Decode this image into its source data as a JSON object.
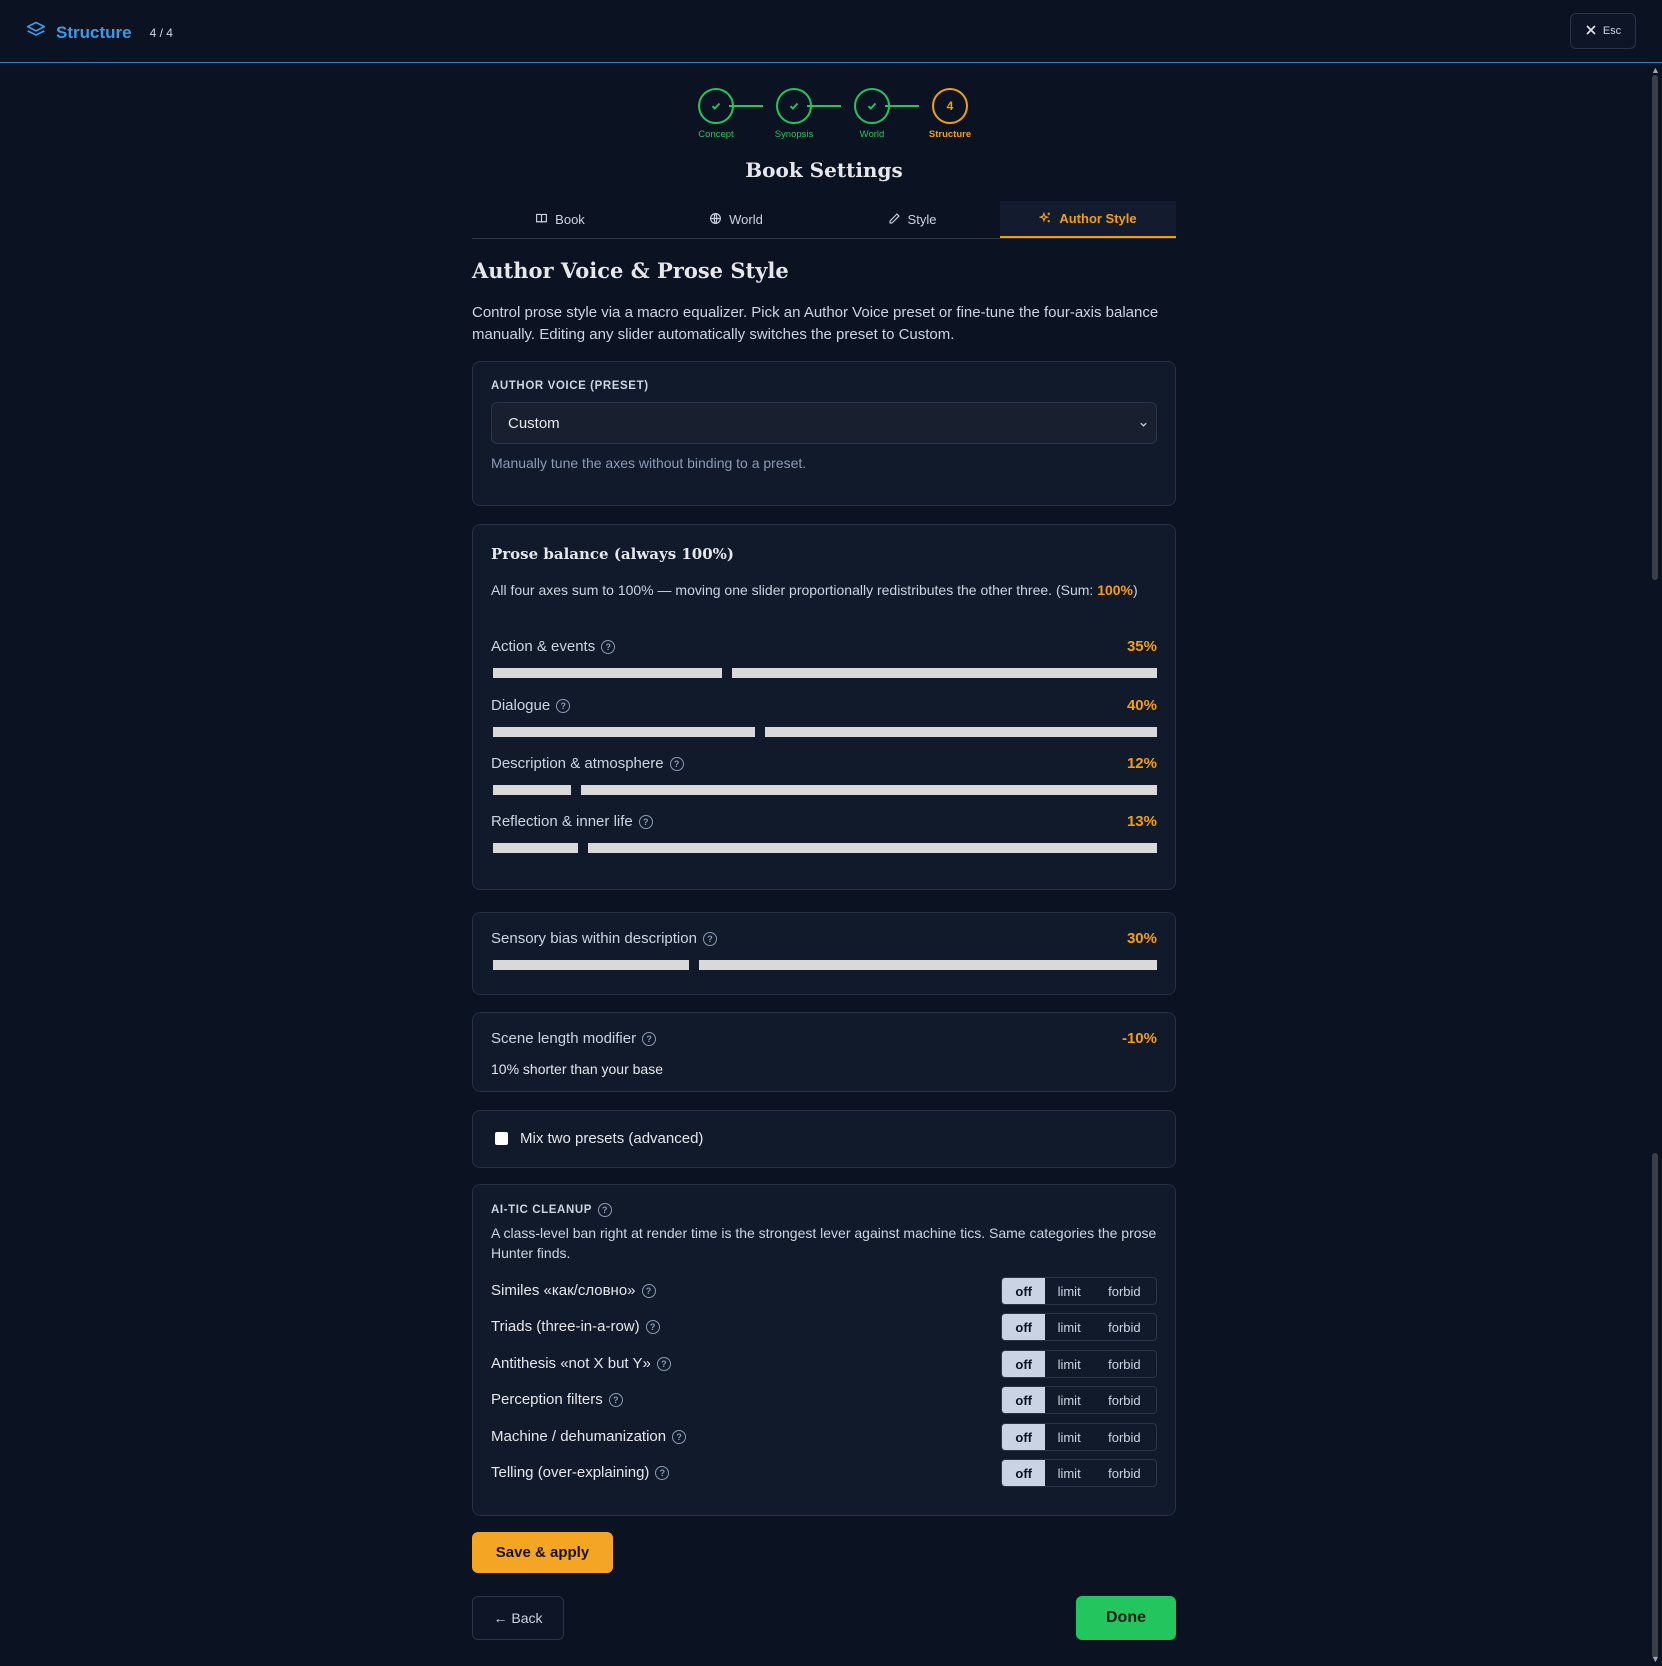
{
  "header": {
    "title": "Structure",
    "step_count": "4 / 4",
    "close_label": "Esc",
    "icons": {
      "logo": "layers-icon",
      "close": "close-icon"
    }
  },
  "stepper": {
    "steps": [
      {
        "label": "Concept",
        "state": "done",
        "icon": "check-icon"
      },
      {
        "label": "Synopsis",
        "state": "done",
        "icon": "check-icon"
      },
      {
        "label": "World",
        "state": "done",
        "icon": "check-icon"
      },
      {
        "label": "Structure",
        "state": "active",
        "number": "4"
      }
    ]
  },
  "page_title": "Book Settings",
  "tabs": [
    {
      "label": "Book",
      "icon": "book-icon"
    },
    {
      "label": "World",
      "icon": "globe-icon"
    },
    {
      "label": "Style",
      "icon": "pencil-icon"
    },
    {
      "label": "Author Style",
      "icon": "sparkles-icon",
      "active": true
    }
  ],
  "section": {
    "title": "Author Voice & Prose Style",
    "intro": "Control prose style via a macro equalizer. Pick an Author Voice preset or fine-tune the four-axis balance manually. Editing any slider automatically switches the preset to Custom."
  },
  "preset": {
    "caption": "AUTHOR VOICE (PRESET)",
    "selected": "Custom",
    "hint": "Manually tune the axes without binding to a preset."
  },
  "balance": {
    "title": "Prose balance (always 100%)",
    "description_prefix": "All four axes sum to 100% — moving one slider proportionally redistributes the other three. (Sum: ",
    "sum": "100%",
    "description_suffix": ")",
    "axes": [
      {
        "label": "Action & events",
        "value_text": "35%",
        "value": 0.35
      },
      {
        "label": "Dialogue",
        "value_text": "40%",
        "value": 0.4
      },
      {
        "label": "Description & atmosphere",
        "value_text": "12%",
        "value": 0.12
      },
      {
        "label": "Reflection & inner life",
        "value_text": "13%",
        "value": 0.13
      }
    ]
  },
  "sensory": {
    "label": "Sensory bias within description",
    "value_text": "30%",
    "value": 0.3
  },
  "scene_length": {
    "label": "Scene length modifier",
    "value_text": "-10%",
    "subtext": "10% shorter than your base"
  },
  "mix": {
    "label": "Mix two presets (advanced)",
    "checked": false
  },
  "cleanup": {
    "caption": "AI-TIC CLEANUP",
    "description": "A class-level ban right at render time is the strongest lever against machine tics. Same categories the prose Hunter finds.",
    "options": [
      "off",
      "limit",
      "forbid"
    ],
    "rows": [
      {
        "label": "Similes «как/словно»",
        "selected": "off"
      },
      {
        "label": "Triads (three-in-a-row)",
        "selected": "off"
      },
      {
        "label": "Antithesis «not X but Y»",
        "selected": "off"
      },
      {
        "label": "Perception filters",
        "selected": "off"
      },
      {
        "label": "Machine / dehumanization",
        "selected": "off"
      },
      {
        "label": "Telling (over-explaining)",
        "selected": "off"
      }
    ]
  },
  "actions": {
    "save": "Save & apply",
    "back": "← Back",
    "done": "Done"
  },
  "colors": {
    "accent": "#f59e0b",
    "success": "#22c55e",
    "brand": "#3b9be8",
    "background": "#0b1222"
  }
}
